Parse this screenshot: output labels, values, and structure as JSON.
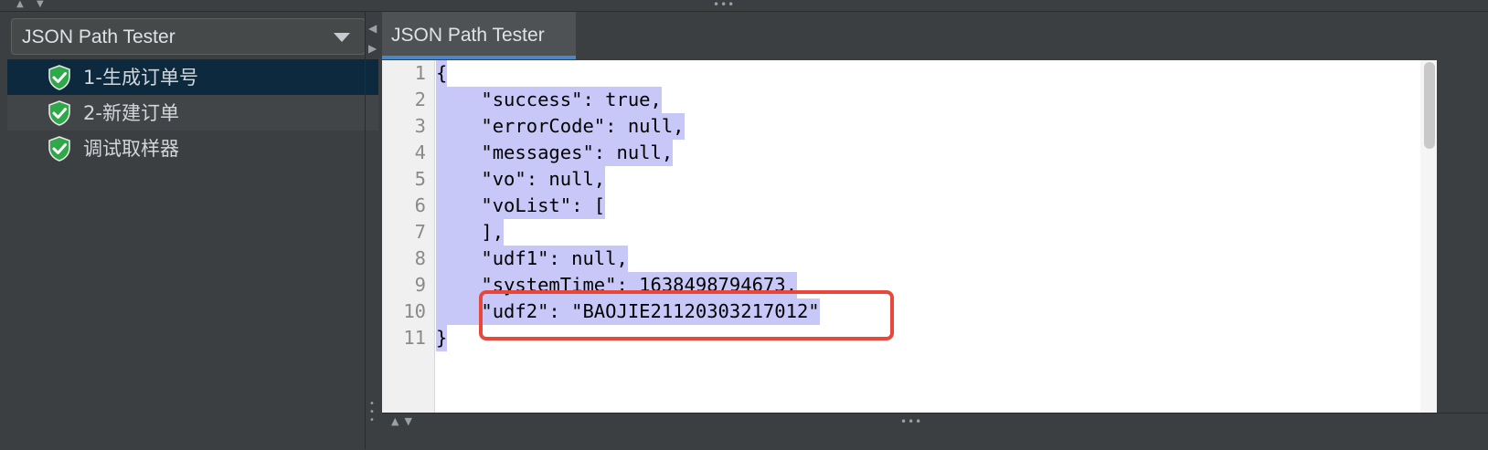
{
  "sidebar": {
    "dropdown_value": "JSON Path Tester",
    "tree": [
      {
        "label": "1-生成订单号",
        "status_icon": "shield-check-icon"
      },
      {
        "label": "2-新建订单",
        "status_icon": "shield-check-icon"
      },
      {
        "label": "调试取样器",
        "status_icon": "shield-check-icon"
      }
    ]
  },
  "tab": {
    "label": "JSON Path Tester"
  },
  "editor": {
    "lines": [
      {
        "num": "1",
        "text": "{"
      },
      {
        "num": "2",
        "text": "    \"success\": true,"
      },
      {
        "num": "3",
        "text": "    \"errorCode\": null,"
      },
      {
        "num": "4",
        "text": "    \"messages\": null,"
      },
      {
        "num": "5",
        "text": "    \"vo\": null,"
      },
      {
        "num": "6",
        "text": "    \"voList\": ["
      },
      {
        "num": "7",
        "text": "    ],"
      },
      {
        "num": "8",
        "text": "    \"udf1\": null,"
      },
      {
        "num": "9",
        "text": "    \"systemTime\": 1638498794673,"
      },
      {
        "num": "10",
        "text": "    \"udf2\": \"BAOJIE21120303217012\""
      },
      {
        "num": "11",
        "text": "}"
      }
    ]
  },
  "colors": {
    "selection": "#c8c8f8",
    "highlight_box": "#e8473a",
    "tab_accent": "#4a88c7",
    "tree_selected": "#0d293e"
  }
}
